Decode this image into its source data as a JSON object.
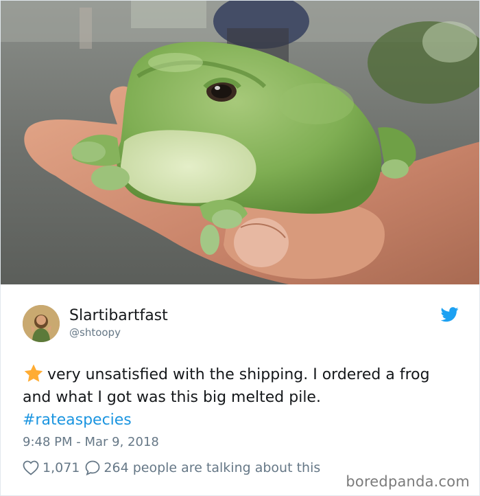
{
  "photo": {
    "alt": "Frog in hand",
    "icon": "frog-photo"
  },
  "tweet": {
    "display_name": "Slartibartfast",
    "handle": "@shtoopy",
    "rating_icon": "star-icon",
    "text_main": "very unsatisfied with the shipping. I ordered a frog and what I got was this big melted pile.",
    "hashtag": "#rateaspecies",
    "timestamp": "9:48 PM - Mar 9, 2018",
    "likes": "1,071",
    "talking": "264 people are talking about this"
  },
  "icons": {
    "brand": "twitter-bird-icon",
    "like": "heart-icon",
    "reply": "reply-bubble-icon"
  },
  "colors": {
    "twitter_blue": "#1da1f2",
    "hashtag": "#1b95e0",
    "secondary_text": "#657786",
    "star": "#ffac33"
  },
  "watermark": "boredpanda.com"
}
